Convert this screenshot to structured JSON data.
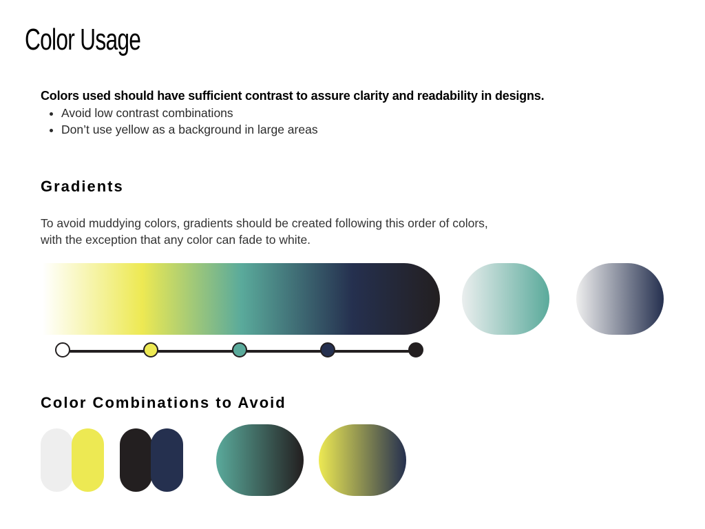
{
  "page": {
    "title": "Color Usage"
  },
  "intro": {
    "lead": "Colors used should have sufficient contrast to assure clarity and readability in designs.",
    "bullets": [
      "Avoid low contrast combinations",
      "Don’t use yellow as a background in large areas"
    ]
  },
  "gradients": {
    "heading": "Gradients",
    "description": "To avoid muddying colors, gradients should be created following this order of colors, with the exception that any color can fade to white.",
    "order": [
      "white",
      "yellow",
      "teal",
      "navy",
      "black"
    ],
    "palette": {
      "white": "#ffffff",
      "yellow": "#ede953",
      "teal": "#5aaa9b",
      "navy": "#25304f",
      "black": "#231f20",
      "light_gray": "#eeeeee"
    },
    "examples": [
      {
        "name": "full-scale",
        "from": "#ffffff",
        "to": "#231f20"
      },
      {
        "name": "white-to-teal",
        "from": "#ffffff",
        "to": "#5aaa9b"
      },
      {
        "name": "white-to-navy",
        "from": "#ffffff",
        "to": "#25304f"
      }
    ]
  },
  "avoid": {
    "heading": "Color Combinations to Avoid",
    "pairs": [
      {
        "left": "#eeeeee",
        "right": "#ede953"
      },
      {
        "left": "#231f20",
        "right": "#25304f"
      }
    ],
    "gradients": [
      {
        "from": "#5aaa9b",
        "to": "#231f20"
      },
      {
        "from": "#ede953",
        "to": "#25304f"
      }
    ]
  }
}
